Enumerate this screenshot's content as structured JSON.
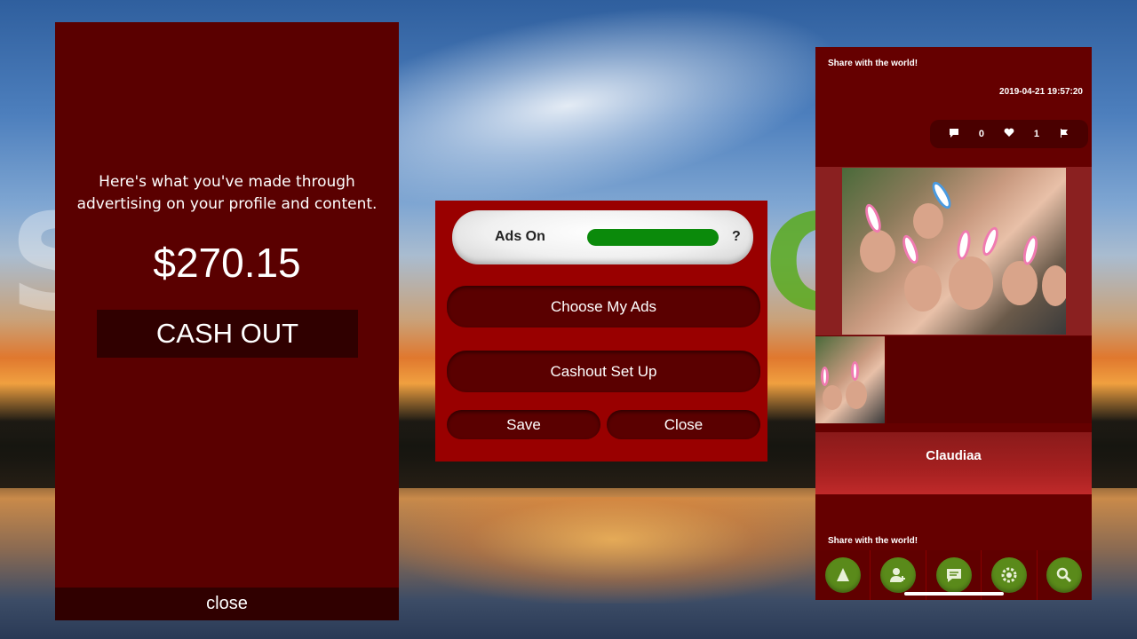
{
  "earnings": {
    "message": "Here's what you've made through advertising on your profile and content.",
    "amount": "$270.15",
    "cashout_label": "CASH OUT",
    "close_label": "close"
  },
  "ads_settings": {
    "toggle_label": "Ads On",
    "toggle_state": "on",
    "help_label": "?",
    "choose_ads_label": "Choose My Ads",
    "cashout_setup_label": "Cashout Set Up",
    "save_label": "Save",
    "close_label": "Close"
  },
  "feed": {
    "share_header": "Share with the world!",
    "post": {
      "timestamp": "2019-04-21 19:57:20",
      "comments_count": "0",
      "likes_count": "1",
      "username": "Claudiaa"
    },
    "share_footer": "Share with the world!",
    "nav_items": [
      {
        "name": "navigate",
        "icon": "navigate-icon"
      },
      {
        "name": "add-user",
        "icon": "add-user-icon"
      },
      {
        "name": "messages",
        "icon": "chat-icon"
      },
      {
        "name": "settings",
        "icon": "gear-icon"
      },
      {
        "name": "search",
        "icon": "search-icon"
      }
    ]
  },
  "colors": {
    "panel_dark_red": "#5a0000",
    "modal_red": "#990000",
    "toggle_green": "#0b8a0b",
    "nav_green": "#5a8a1a"
  }
}
